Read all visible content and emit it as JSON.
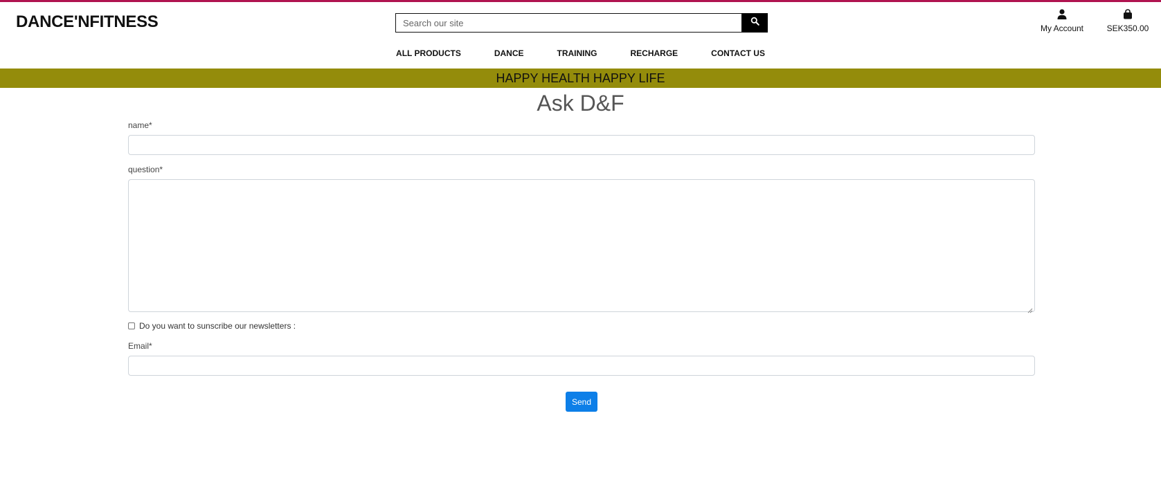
{
  "brand": {
    "logo_text": "DANCE'NFITNESS",
    "accent_color": "#b0134f"
  },
  "header": {
    "search": {
      "placeholder": "Search our site",
      "button_icon": "search-icon"
    },
    "account": {
      "label": "My Account",
      "icon": "user-icon"
    },
    "bag": {
      "label": "SEK350.00",
      "icon": "shopping-bag-icon"
    }
  },
  "nav": {
    "items": [
      {
        "label": "ALL PRODUCTS"
      },
      {
        "label": "DANCE"
      },
      {
        "label": "TRAINING"
      },
      {
        "label": "RECHARGE"
      },
      {
        "label": "CONTACT US"
      }
    ]
  },
  "banner": {
    "text": "HAPPY HEALTH HAPPY LIFE",
    "color": "#948c0b"
  },
  "page": {
    "title": "Ask D&F"
  },
  "form": {
    "name_label": "name*",
    "name_value": "",
    "question_label": "question*",
    "question_value": "",
    "newsletter_label": "Do you want to sunscribe our newsletters :",
    "newsletter_checked": false,
    "email_label": "Email*",
    "email_value": "",
    "submit_label": "Send",
    "submit_color": "#0d7fe8"
  }
}
